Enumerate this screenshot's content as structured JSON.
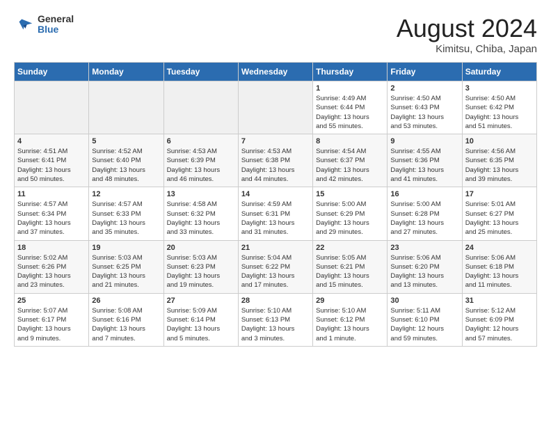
{
  "header": {
    "logo_line1": "General",
    "logo_line2": "Blue",
    "main_title": "August 2024",
    "subtitle": "Kimitsu, Chiba, Japan"
  },
  "days_of_week": [
    "Sunday",
    "Monday",
    "Tuesday",
    "Wednesday",
    "Thursday",
    "Friday",
    "Saturday"
  ],
  "weeks": [
    [
      {
        "day": "",
        "info": ""
      },
      {
        "day": "",
        "info": ""
      },
      {
        "day": "",
        "info": ""
      },
      {
        "day": "",
        "info": ""
      },
      {
        "day": "1",
        "info": "Sunrise: 4:49 AM\nSunset: 6:44 PM\nDaylight: 13 hours\nand 55 minutes."
      },
      {
        "day": "2",
        "info": "Sunrise: 4:50 AM\nSunset: 6:43 PM\nDaylight: 13 hours\nand 53 minutes."
      },
      {
        "day": "3",
        "info": "Sunrise: 4:50 AM\nSunset: 6:42 PM\nDaylight: 13 hours\nand 51 minutes."
      }
    ],
    [
      {
        "day": "4",
        "info": "Sunrise: 4:51 AM\nSunset: 6:41 PM\nDaylight: 13 hours\nand 50 minutes."
      },
      {
        "day": "5",
        "info": "Sunrise: 4:52 AM\nSunset: 6:40 PM\nDaylight: 13 hours\nand 48 minutes."
      },
      {
        "day": "6",
        "info": "Sunrise: 4:53 AM\nSunset: 6:39 PM\nDaylight: 13 hours\nand 46 minutes."
      },
      {
        "day": "7",
        "info": "Sunrise: 4:53 AM\nSunset: 6:38 PM\nDaylight: 13 hours\nand 44 minutes."
      },
      {
        "day": "8",
        "info": "Sunrise: 4:54 AM\nSunset: 6:37 PM\nDaylight: 13 hours\nand 42 minutes."
      },
      {
        "day": "9",
        "info": "Sunrise: 4:55 AM\nSunset: 6:36 PM\nDaylight: 13 hours\nand 41 minutes."
      },
      {
        "day": "10",
        "info": "Sunrise: 4:56 AM\nSunset: 6:35 PM\nDaylight: 13 hours\nand 39 minutes."
      }
    ],
    [
      {
        "day": "11",
        "info": "Sunrise: 4:57 AM\nSunset: 6:34 PM\nDaylight: 13 hours\nand 37 minutes."
      },
      {
        "day": "12",
        "info": "Sunrise: 4:57 AM\nSunset: 6:33 PM\nDaylight: 13 hours\nand 35 minutes."
      },
      {
        "day": "13",
        "info": "Sunrise: 4:58 AM\nSunset: 6:32 PM\nDaylight: 13 hours\nand 33 minutes."
      },
      {
        "day": "14",
        "info": "Sunrise: 4:59 AM\nSunset: 6:31 PM\nDaylight: 13 hours\nand 31 minutes."
      },
      {
        "day": "15",
        "info": "Sunrise: 5:00 AM\nSunset: 6:29 PM\nDaylight: 13 hours\nand 29 minutes."
      },
      {
        "day": "16",
        "info": "Sunrise: 5:00 AM\nSunset: 6:28 PM\nDaylight: 13 hours\nand 27 minutes."
      },
      {
        "day": "17",
        "info": "Sunrise: 5:01 AM\nSunset: 6:27 PM\nDaylight: 13 hours\nand 25 minutes."
      }
    ],
    [
      {
        "day": "18",
        "info": "Sunrise: 5:02 AM\nSunset: 6:26 PM\nDaylight: 13 hours\nand 23 minutes."
      },
      {
        "day": "19",
        "info": "Sunrise: 5:03 AM\nSunset: 6:25 PM\nDaylight: 13 hours\nand 21 minutes."
      },
      {
        "day": "20",
        "info": "Sunrise: 5:03 AM\nSunset: 6:23 PM\nDaylight: 13 hours\nand 19 minutes."
      },
      {
        "day": "21",
        "info": "Sunrise: 5:04 AM\nSunset: 6:22 PM\nDaylight: 13 hours\nand 17 minutes."
      },
      {
        "day": "22",
        "info": "Sunrise: 5:05 AM\nSunset: 6:21 PM\nDaylight: 13 hours\nand 15 minutes."
      },
      {
        "day": "23",
        "info": "Sunrise: 5:06 AM\nSunset: 6:20 PM\nDaylight: 13 hours\nand 13 minutes."
      },
      {
        "day": "24",
        "info": "Sunrise: 5:06 AM\nSunset: 6:18 PM\nDaylight: 13 hours\nand 11 minutes."
      }
    ],
    [
      {
        "day": "25",
        "info": "Sunrise: 5:07 AM\nSunset: 6:17 PM\nDaylight: 13 hours\nand 9 minutes."
      },
      {
        "day": "26",
        "info": "Sunrise: 5:08 AM\nSunset: 6:16 PM\nDaylight: 13 hours\nand 7 minutes."
      },
      {
        "day": "27",
        "info": "Sunrise: 5:09 AM\nSunset: 6:14 PM\nDaylight: 13 hours\nand 5 minutes."
      },
      {
        "day": "28",
        "info": "Sunrise: 5:10 AM\nSunset: 6:13 PM\nDaylight: 13 hours\nand 3 minutes."
      },
      {
        "day": "29",
        "info": "Sunrise: 5:10 AM\nSunset: 6:12 PM\nDaylight: 13 hours\nand 1 minute."
      },
      {
        "day": "30",
        "info": "Sunrise: 5:11 AM\nSunset: 6:10 PM\nDaylight: 12 hours\nand 59 minutes."
      },
      {
        "day": "31",
        "info": "Sunrise: 5:12 AM\nSunset: 6:09 PM\nDaylight: 12 hours\nand 57 minutes."
      }
    ]
  ]
}
